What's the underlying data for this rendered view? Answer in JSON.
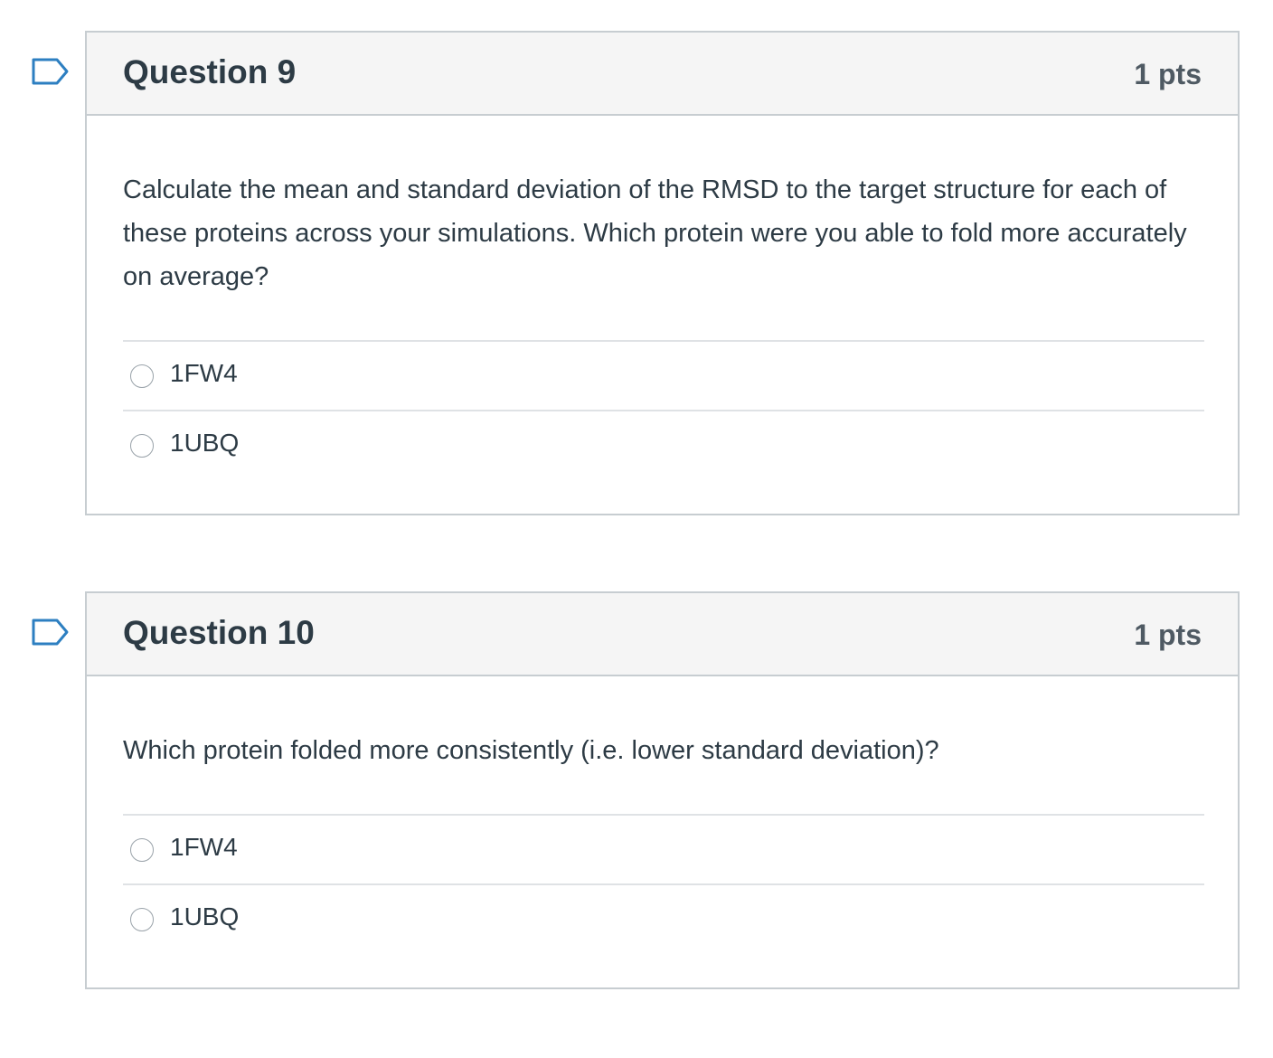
{
  "questions": [
    {
      "title": "Question 9",
      "points": "1 pts",
      "text": "Calculate the mean and standard deviation of the RMSD to the target structure for each of these proteins across your simulations. Which protein were you able to fold more accurately on average?",
      "answers": [
        {
          "label": "1FW4"
        },
        {
          "label": "1UBQ"
        }
      ]
    },
    {
      "title": "Question 10",
      "points": "1 pts",
      "text": "Which protein folded more consistently (i.e. lower standard deviation)?",
      "answers": [
        {
          "label": "1FW4"
        },
        {
          "label": "1UBQ"
        }
      ]
    }
  ],
  "colors": {
    "flag": "#2d7fc1",
    "header_bg": "#f5f5f5",
    "border": "#c7cdd1",
    "text": "#2d3b45"
  },
  "icons": {
    "flag": "bookmark-flag-icon",
    "radio": "radio-unchecked-icon"
  }
}
